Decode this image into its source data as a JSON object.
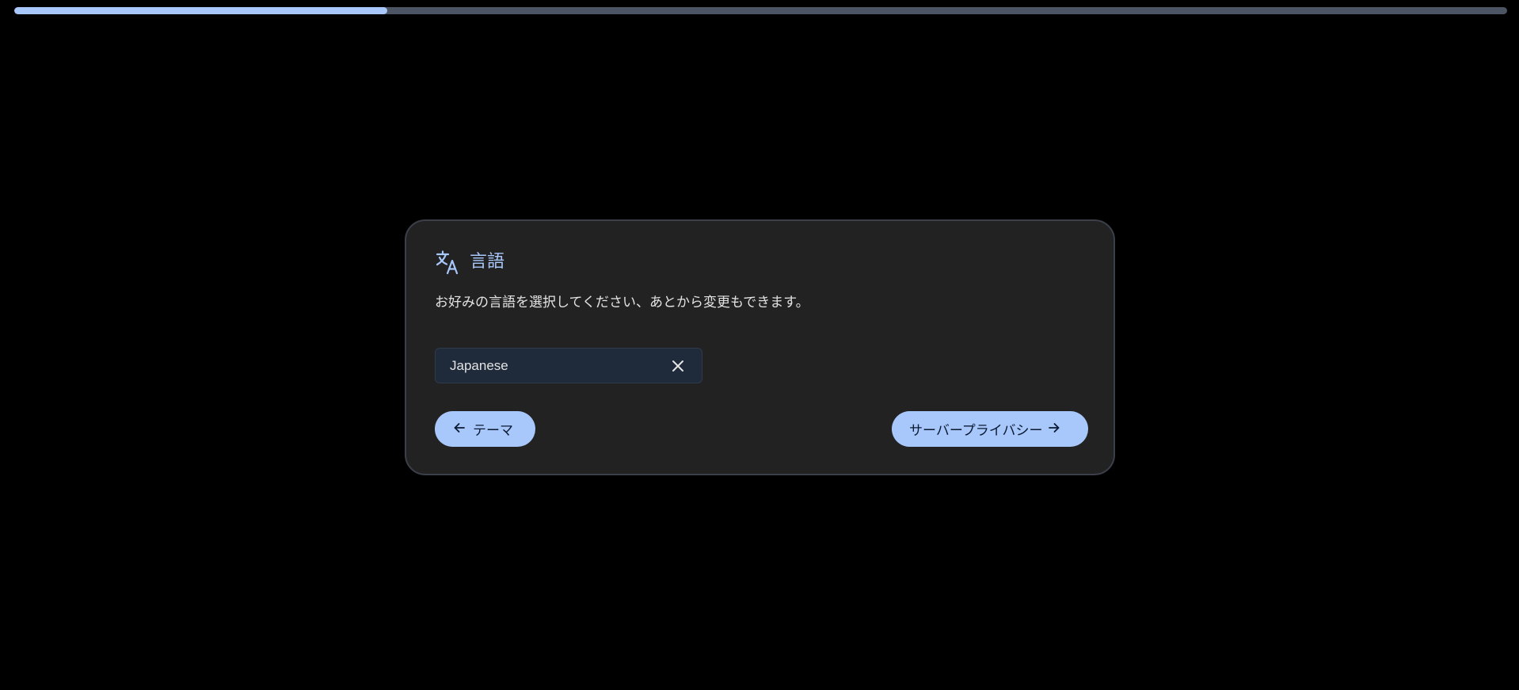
{
  "progress": {
    "value": 0.25
  },
  "language_card": {
    "icon": "translate-icon",
    "title": "言語",
    "description": "お好みの言語を選択してください、あとから変更もできます。",
    "select": {
      "value": "Japanese",
      "clear_icon": "close-icon"
    },
    "back_button": {
      "label": "テーマ",
      "icon": "arrow-left-icon"
    },
    "next_button": {
      "label": "サーバープライバシー",
      "icon": "arrow-right-icon"
    }
  },
  "colors": {
    "background": "#000000",
    "card": "#222222",
    "accent": "#a8c7fa",
    "progress_track": "#4c5564",
    "select_bg": "#1f2a3a"
  }
}
